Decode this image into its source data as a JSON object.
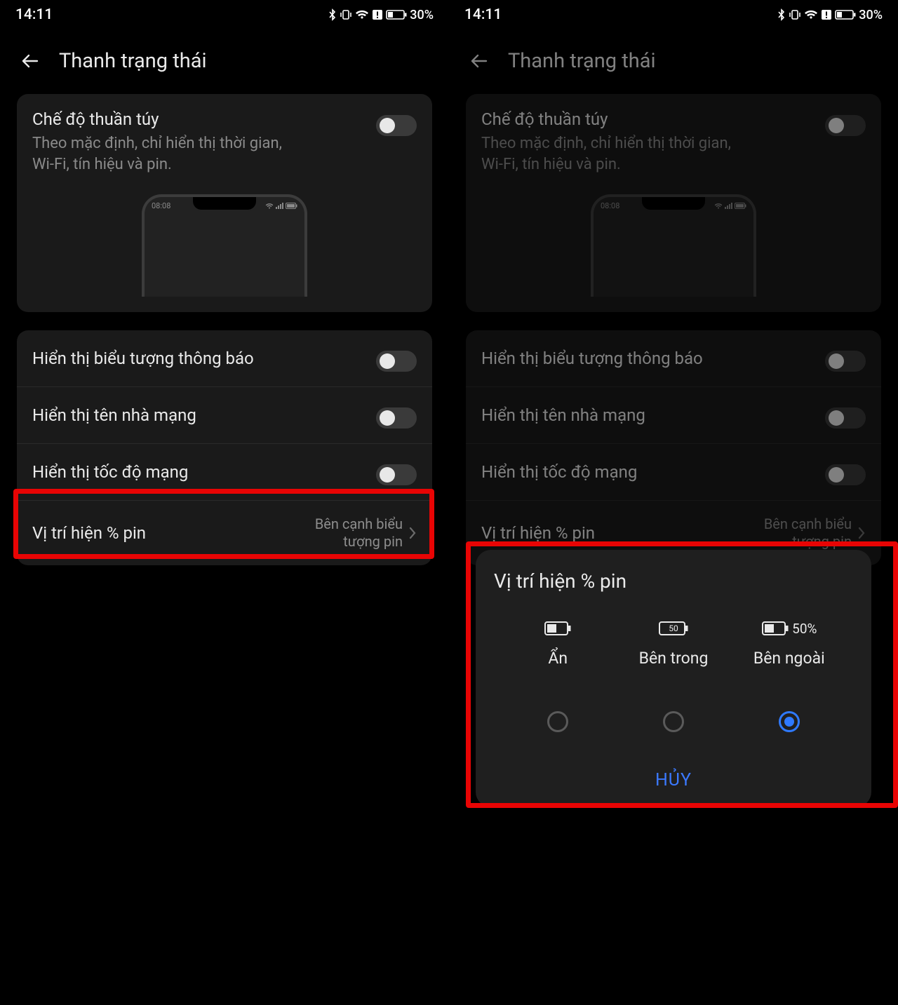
{
  "statusBar": {
    "time": "14:11",
    "battery": "30%"
  },
  "page": {
    "title": "Thanh trạng thái",
    "pureMode": {
      "title": "Chế độ thuần túy",
      "desc": "Theo mặc định, chỉ hiển thị thời gian, Wi-Fi, tín hiệu và pin.",
      "mockTime": "08:08"
    },
    "rows": {
      "notifIcons": {
        "label": "Hiển thị biểu tượng thông báo"
      },
      "carrier": {
        "label": "Hiển thị tên nhà mạng"
      },
      "netSpeed": {
        "label": "Hiển thị tốc độ mạng"
      },
      "battPos": {
        "label": "Vị trí hiện % pin",
        "value": "Bên cạnh biểu tượng pin"
      }
    }
  },
  "dialog": {
    "title": "Vị trí hiện % pin",
    "options": {
      "hide": {
        "label": "Ẩn"
      },
      "inside": {
        "label": "Bên trong",
        "iconText": "50"
      },
      "outside": {
        "label": "Bên ngoài",
        "iconText": "50%"
      }
    },
    "cancel": "HỦY"
  }
}
